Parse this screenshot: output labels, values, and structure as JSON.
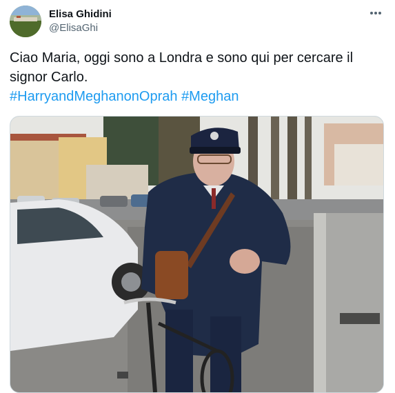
{
  "author": {
    "display_name": "Elisa Ghidini",
    "handle": "@ElisaGhi"
  },
  "tweet": {
    "text_line1": "Ciao Maria, oggi sono a Londra e sono qui per cercare il",
    "text_line2": "signor Carlo.",
    "hashtags": [
      "#HarryandMeghanonOprah",
      "#Meghan"
    ]
  },
  "icons": {
    "more": "more-horizontal-icon"
  },
  "colors": {
    "hashtag": "#1d9bf0",
    "text": "#0f1419",
    "secondary_text": "#536471"
  }
}
